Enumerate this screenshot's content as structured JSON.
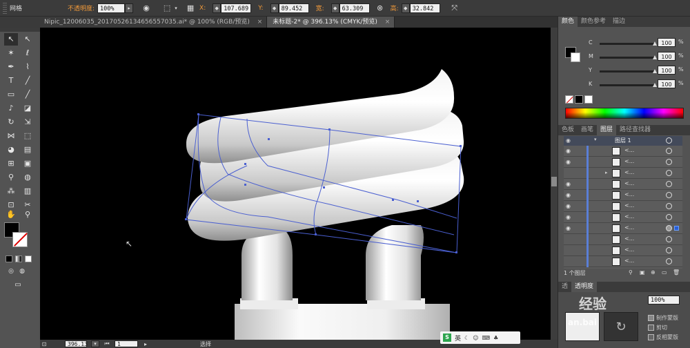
{
  "control_bar": {
    "mode": "网格",
    "opacity_label": "不透明度:",
    "opacity_value": "100%",
    "x_label": "X:",
    "x_value": "107.689",
    "y_label": "Y:",
    "y_value": "89.452",
    "w_label": "宽:",
    "w_value": "63.309",
    "h_label": "高:",
    "h_value": "32.842"
  },
  "tabs": [
    {
      "label": "Nipic_12006035_20170526134656557035.ai* @ 100% (RGB/预览)",
      "close": "×"
    },
    {
      "label": "未标题-2* @ 396.13% (CMYK/预览)",
      "close": "×"
    }
  ],
  "color_panel": {
    "tabs": [
      "颜色",
      "颜色参考",
      "描边"
    ],
    "channels": [
      {
        "name": "C",
        "value": "100",
        "unit": "%"
      },
      {
        "name": "M",
        "value": "100",
        "unit": "%"
      },
      {
        "name": "Y",
        "value": "100",
        "unit": "%"
      },
      {
        "name": "K",
        "value": "100",
        "unit": "%"
      }
    ]
  },
  "layers_panel": {
    "tabs": [
      "色板",
      "画笔",
      "图层",
      "路径查找器"
    ],
    "active_tab": "图层",
    "top_layer": "图层 1",
    "item_label": "<...",
    "status": "1 个图层"
  },
  "bottom_panel": {
    "tabs": [
      "透",
      "透明度"
    ],
    "opacity": "100%",
    "make_mask": "制作蒙版",
    "clip": "剪切",
    "invert": "反相蒙版",
    "watermark": "经验",
    "site": "an.bai"
  },
  "status_bar": {
    "zoom": "396.13",
    "page": "1",
    "tool": "选择"
  },
  "colors": {
    "ui_dark": "#3b3b3b",
    "ui_mid": "#535353",
    "canvas": "#000000",
    "selection": "#4a5fd0",
    "accent_orange": "#f29a3a"
  }
}
